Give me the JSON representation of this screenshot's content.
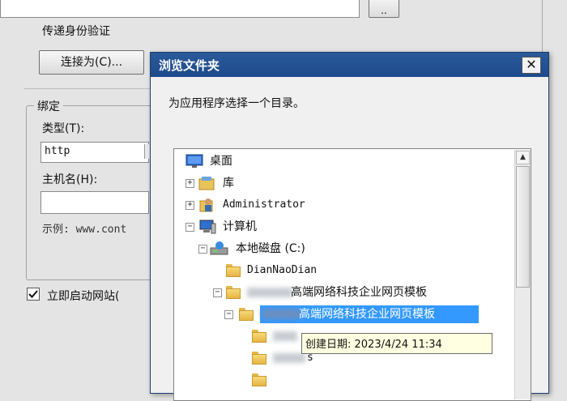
{
  "background_dialog": {
    "browse_button_label": "..",
    "pass_through_auth_label": "传递身份验证",
    "connect_as_label": "连接为(C)...",
    "binding_group_label": "绑定",
    "type_label": "类型(T):",
    "type_value": "http",
    "hostname_label": "主机名(H):",
    "example_text": "示例: www.cont",
    "start_site_label": "立即启动网站("
  },
  "browse_dialog": {
    "title": "浏览文件夹",
    "close_glyph": "✕",
    "instruction": "为应用程序选择一个目录。",
    "tree": {
      "desktop": "桌面",
      "libraries": "库",
      "administrator": "Administrator",
      "computer": "计算机",
      "local_disk": "本地磁盘 (C:)",
      "folder_dian": "DianNaoDian",
      "folder_template_1": "高端网络科技企业网页模板",
      "folder_template_2": "高端网络科技企业网页模板",
      "partial_1": "s"
    },
    "tooltip": "创建日期: 2023/4/24 11:34"
  },
  "icons": [
    "folder-icon",
    "desktop-icon",
    "library-icon",
    "user-icon",
    "computer-icon",
    "disk-icon",
    "close-icon",
    "checkbox-checked-icon",
    "dropdown-arrow-icon",
    "scroll-up-icon"
  ],
  "colors": {
    "title_bar": "#1e4a8a",
    "selection": "#3399ff",
    "tooltip_bg": "#ffffe1"
  }
}
